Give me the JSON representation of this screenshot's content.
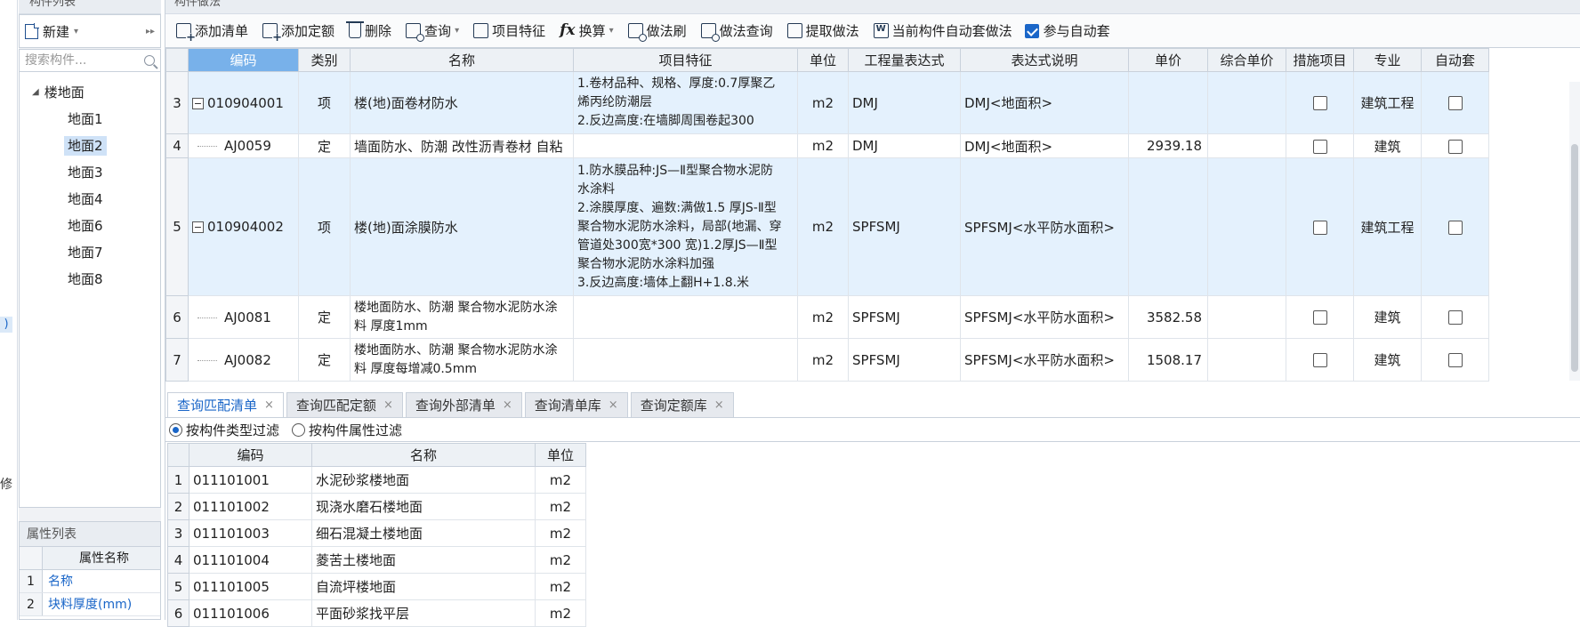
{
  "left_edge": {
    "mark_zero": ")",
    "mark_xiu": "修"
  },
  "component_list": {
    "title": "构件列表",
    "new_label": "新建",
    "more": "▸▸",
    "search_placeholder": "搜索构件...",
    "tree": {
      "root": "楼地面",
      "items": [
        {
          "label": "地面1"
        },
        {
          "label": "地面2"
        },
        {
          "label": "地面3"
        },
        {
          "label": "地面4"
        },
        {
          "label": "地面6"
        },
        {
          "label": "地面7"
        },
        {
          "label": "地面8"
        }
      ],
      "selected_index": 1
    }
  },
  "property_list": {
    "title": "属性列表",
    "header": "属性名称",
    "rows": [
      {
        "idx": "1",
        "name": "名称"
      },
      {
        "idx": "2",
        "name": "块料厚度(mm)"
      }
    ]
  },
  "main": {
    "title": "构件做法",
    "toolbar": {
      "add_list": "添加清单",
      "add_quota": "添加定额",
      "delete": "删除",
      "query": "查询",
      "item_feature": "项目特征",
      "convert": "换算",
      "method_brush": "做法刷",
      "method_query": "做法查询",
      "extract_method": "提取做法",
      "current_auto_method": "当前构件自动套做法",
      "auto_apply_label": "参与自动套",
      "auto_apply_checked": true
    },
    "table": {
      "headers": {
        "code": "编码",
        "type": "类别",
        "name": "名称",
        "feature": "项目特征",
        "unit": "单位",
        "expr": "工程量表达式",
        "expr_desc": "表达式说明",
        "price": "单价",
        "total_price": "综合单价",
        "measure": "措施项目",
        "major": "专业",
        "auto": "自动套"
      },
      "rows": [
        {
          "idx": "3",
          "code": "010904001",
          "type": "项",
          "name": "楼(地)面卷材防水",
          "feature": "1.卷材品种、规格、厚度:0.7厚聚乙\n烯丙纶防潮层\n2.反边高度:在墙脚周围卷起300",
          "unit": "m2",
          "expr": "DMJ",
          "expr_desc": "DMJ<地面积>",
          "price": "",
          "total_price": "",
          "major": "建筑工程"
        },
        {
          "idx": "4",
          "code": "AJ0059",
          "type": "定",
          "name": "墙面防水、防潮 改性沥青卷材 自粘",
          "feature": "",
          "unit": "m2",
          "expr": "DMJ",
          "expr_desc": "DMJ<地面积>",
          "price": "2939.18",
          "total_price": "",
          "major": "建筑"
        },
        {
          "idx": "5",
          "code": "010904002",
          "type": "项",
          "name": "楼(地)面涂膜防水",
          "feature": "1.防水膜品种:JS—Ⅱ型聚合物水泥防\n水涂料\n2.涂膜厚度、遍数:满做1.5 厚JS-Ⅱ型\n聚合物水泥防水涂料，局部(地漏、穿\n管道处300宽*300 宽)1.2厚JS—Ⅱ型\n聚合物水泥防水涂料加强\n3.反边高度:墙体上翻H+1.8.米",
          "unit": "m2",
          "expr": "SPFSMJ",
          "expr_desc": "SPFSMJ<水平防水面积>",
          "price": "",
          "total_price": "",
          "major": "建筑工程"
        },
        {
          "idx": "6",
          "code": "AJ0081",
          "type": "定",
          "name": "楼地面防水、防潮 聚合物水泥防水涂\n料 厚度1mm",
          "feature": "",
          "unit": "m2",
          "expr": "SPFSMJ",
          "expr_desc": "SPFSMJ<水平防水面积>",
          "price": "3582.58",
          "total_price": "",
          "major": "建筑"
        },
        {
          "idx": "7",
          "code": "AJ0082",
          "type": "定",
          "name": "楼地面防水、防潮 聚合物水泥防水涂\n料 厚度每增减0.5mm",
          "feature": "",
          "unit": "m2",
          "expr": "SPFSMJ",
          "expr_desc": "SPFSMJ<水平防水面积>",
          "price": "1508.17",
          "total_price": "",
          "major": "建筑"
        }
      ]
    },
    "tabs": [
      {
        "label": "查询匹配清单",
        "active": true
      },
      {
        "label": "查询匹配定额"
      },
      {
        "label": "查询外部清单"
      },
      {
        "label": "查询清单库"
      },
      {
        "label": "查询定额库"
      }
    ],
    "filter": {
      "by_type": "按构件类型过滤",
      "by_attr": "按构件属性过滤"
    },
    "match_table": {
      "headers": {
        "code": "编码",
        "name": "名称",
        "unit": "单位"
      },
      "rows": [
        {
          "idx": "1",
          "code": "011101001",
          "name": "水泥砂浆楼地面",
          "unit": "m2"
        },
        {
          "idx": "2",
          "code": "011101002",
          "name": "现浇水磨石楼地面",
          "unit": "m2"
        },
        {
          "idx": "3",
          "code": "011101003",
          "name": "细石混凝土楼地面",
          "unit": "m2"
        },
        {
          "idx": "4",
          "code": "011101004",
          "name": "菱苦土楼地面",
          "unit": "m2"
        },
        {
          "idx": "5",
          "code": "011101005",
          "name": "自流坪楼地面",
          "unit": "m2"
        },
        {
          "idx": "6",
          "code": "011101006",
          "name": "平面砂浆找平层",
          "unit": "m2"
        }
      ]
    }
  }
}
